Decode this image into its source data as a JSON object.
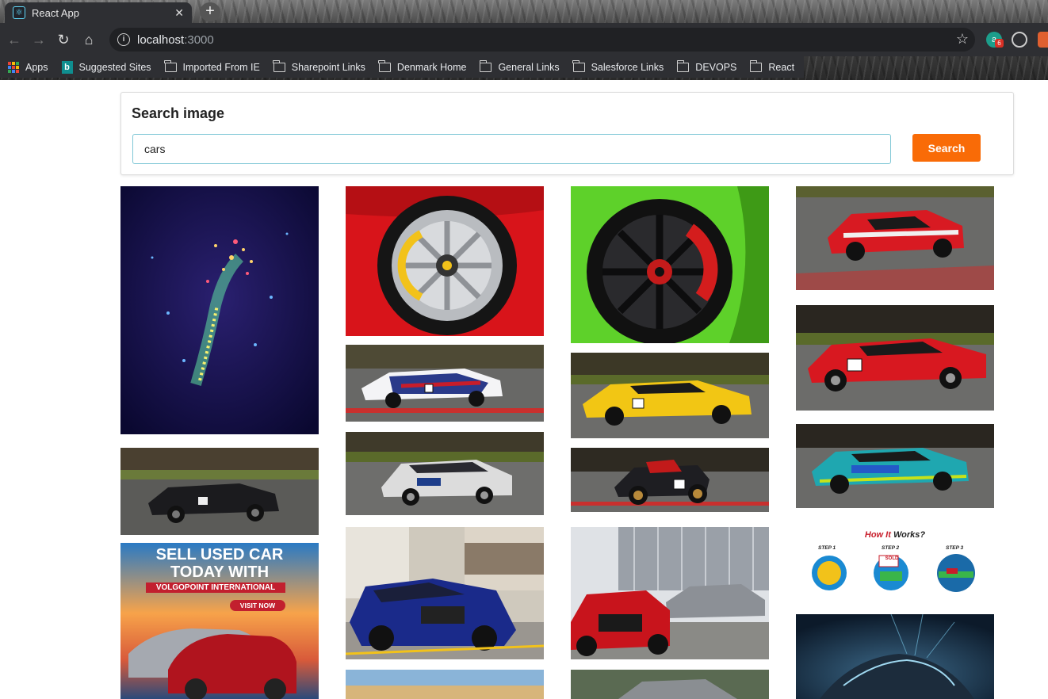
{
  "browser": {
    "tab_title": "React App",
    "tab_close": "✕",
    "new_tab": "+",
    "url_host": "localhost",
    "url_port": ":3000",
    "bookmarks": [
      "Apps",
      "Suggested Sites",
      "Imported From IE",
      "Sharepoint Links",
      "Denmark Home",
      "General Links",
      "Salesforce Links",
      "DEVOPS",
      "React"
    ],
    "extension_badge": "6"
  },
  "search": {
    "title": "Search image",
    "query": "cars",
    "button_label": "Search"
  },
  "ads": {
    "sell_line1": "SELL USED CAR",
    "sell_line2": "TODAY WITH",
    "sell_brand": "VOLGOPOINT INTERNATIONAL",
    "sell_cta": "VISIT NOW",
    "how_title_a": "How It",
    "how_title_b": "Works?",
    "step1": "STEP 1",
    "step2": "STEP 2",
    "step3": "STEP 3",
    "sold": "SOLD"
  },
  "colors": {
    "accent": "#f96b07",
    "input_border": "#7fc7d6"
  }
}
